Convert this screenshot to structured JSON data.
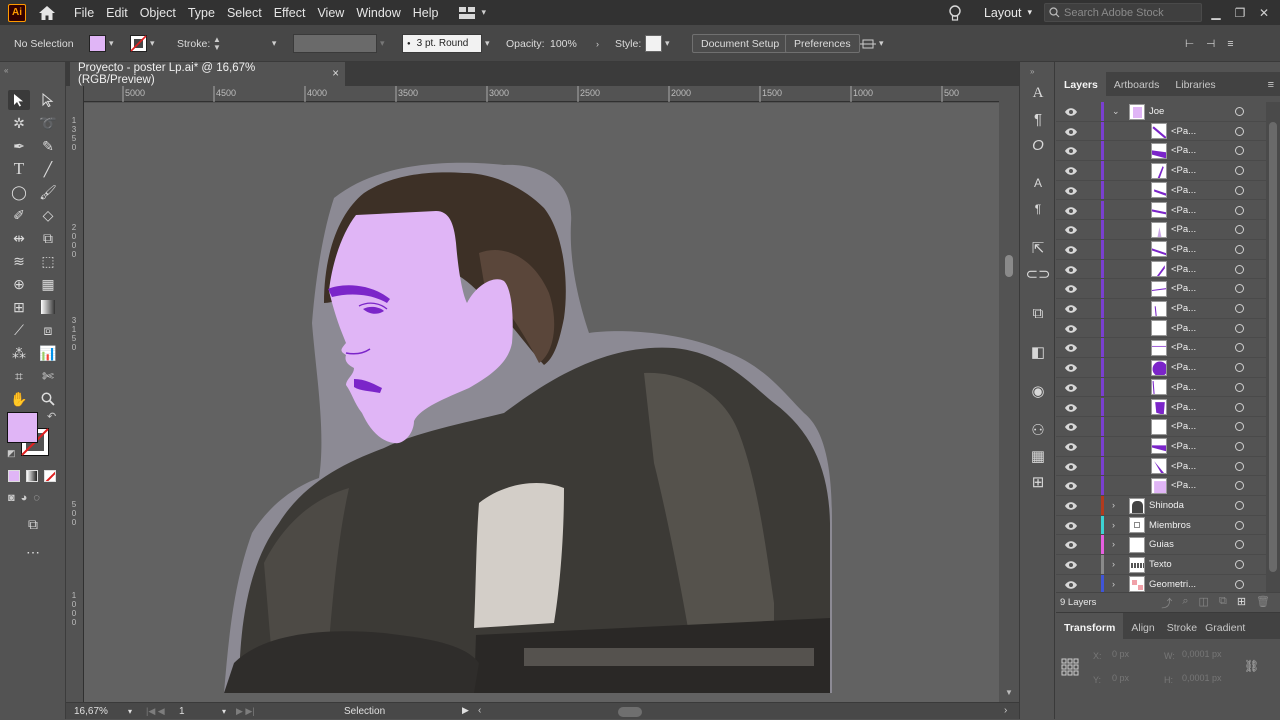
{
  "app": {
    "logo": "Ai",
    "colors": {
      "accent": "#ff9a00",
      "fill": "#e0b5f6",
      "purple": "#7b25c9",
      "layer_joe": "#7a3fd0"
    }
  },
  "menu": [
    "File",
    "Edit",
    "Object",
    "Type",
    "Select",
    "Effect",
    "View",
    "Window",
    "Help"
  ],
  "workspace": {
    "label": "Layout"
  },
  "search": {
    "placeholder": "Search Adobe Stock"
  },
  "control": {
    "selection_label": "No Selection",
    "stroke_label": "Stroke:",
    "brush_value": "3 pt. Round",
    "opacity_label": "Opacity:",
    "opacity_value": "100%",
    "style_label": "Style:",
    "doc_setup": "Document Setup",
    "preferences": "Preferences"
  },
  "document": {
    "tab_title": "Proyecto - poster Lp.ai* @ 16,67% (RGB/Preview)",
    "close": "×"
  },
  "ruler": {
    "h": [
      "5000",
      "4500",
      "4000",
      "3500",
      "3000",
      "2500",
      "2000",
      "1500",
      "1000",
      "500"
    ],
    "v1": [
      "1",
      "3",
      "5",
      "0"
    ],
    "v2": [
      "2",
      "0",
      "0",
      "0"
    ],
    "v3": [
      "3",
      "1",
      "5",
      "0"
    ],
    "v4": [
      "5",
      "0",
      "0"
    ],
    "v5": [
      "1",
      "0",
      "0",
      "0"
    ]
  },
  "status": {
    "zoom": "16,67%",
    "page": "1",
    "tool": "Selection"
  },
  "layers_panel": {
    "tabs": [
      "Layers",
      "Artboards",
      "Libraries"
    ],
    "parent": "Joe",
    "sublayers": [
      "<Pa...",
      "<Pa...",
      "<Pa...",
      "<Pa...",
      "<Pa...",
      "<Pa...",
      "<Pa...",
      "<Pa...",
      "<Pa...",
      "<Pa...",
      "<Pa...",
      "<Pa...",
      "<Pa...",
      "<Pa...",
      "<Pa...",
      "<Pa...",
      "<Pa...",
      "<Pa...",
      "<Pa..."
    ],
    "layers": [
      {
        "name": "Shinoda",
        "color": "#b23b1e"
      },
      {
        "name": "Miembros",
        "color": "#3dd3d3"
      },
      {
        "name": "Guias",
        "color": "#e75fe0"
      },
      {
        "name": "Texto",
        "color": "#8a8a8a"
      },
      {
        "name": "Geometri...",
        "color": "#3f55d8"
      }
    ],
    "count": "9 Layers"
  },
  "transform_panel": {
    "tabs": [
      "Transform",
      "Align",
      "Stroke",
      "Gradient"
    ],
    "x_label": "X:",
    "x_value": "0 px",
    "y_label": "Y:",
    "y_value": "0 px",
    "w_label": "W:",
    "w_value": "0,0001 px",
    "h_label": "H:",
    "h_value": "0,0001 px"
  }
}
